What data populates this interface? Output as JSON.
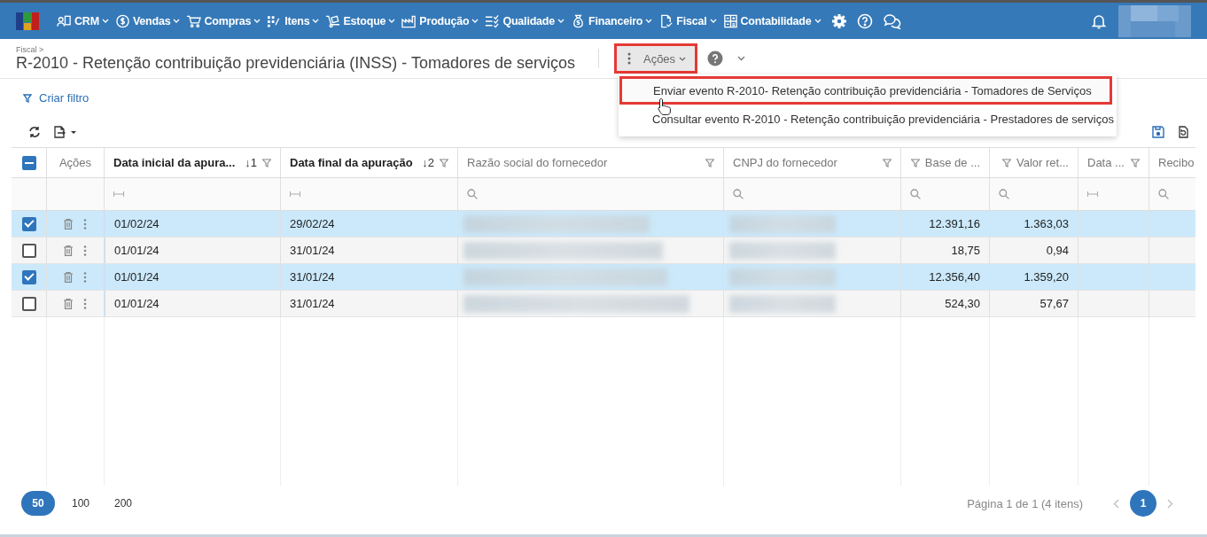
{
  "nav": {
    "items": [
      {
        "label": "CRM",
        "kind": "crm"
      },
      {
        "label": "Vendas",
        "kind": "sales"
      },
      {
        "label": "Compras",
        "kind": "purchases"
      },
      {
        "label": "Itens",
        "kind": "items"
      },
      {
        "label": "Estoque",
        "kind": "stock"
      },
      {
        "label": "Produção",
        "kind": "production"
      },
      {
        "label": "Qualidade",
        "kind": "quality"
      },
      {
        "label": "Financeiro",
        "kind": "finance"
      },
      {
        "label": "Fiscal",
        "kind": "fiscal"
      },
      {
        "label": "Contabilidade",
        "kind": "accounting"
      }
    ]
  },
  "breadcrumb": "Fiscal >",
  "title": "R-2010 - Retenção contribuição previdenciária (INSS) - Tomadores de serviços",
  "actions_button": {
    "label": "Ações",
    "highlighted": true
  },
  "actions_menu": {
    "items": [
      {
        "label": "Enviar evento R-2010- Retenção contribuição previdenciária - Tomadores de Serviços",
        "highlighted": true
      },
      {
        "label": "Consultar evento R-2010 - Retenção contribuição previdenciária - Prestadores de serviços",
        "highlighted": false
      }
    ]
  },
  "filter_link": "Criar filtro",
  "table": {
    "select_all": {
      "indeterminate": true
    },
    "columns": [
      {
        "label": "Ações",
        "kind": "actions",
        "filterable": false
      },
      {
        "label": "Data inicial da apura...",
        "kind": "date",
        "sort": "↓1",
        "filterable": true
      },
      {
        "label": "Data final da apuração",
        "kind": "date",
        "sort": "↓2",
        "filterable": true
      },
      {
        "label": "Razão social do fornecedor",
        "kind": "text",
        "filterable": true
      },
      {
        "label": "CNPJ do fornecedor",
        "kind": "text",
        "filterable": true
      },
      {
        "label": "Base de ...",
        "kind": "number",
        "filterable": true
      },
      {
        "label": "Valor ret...",
        "kind": "number",
        "filterable": true
      },
      {
        "label": "Data ...",
        "kind": "date",
        "filterable": true
      },
      {
        "label": "Recibo",
        "kind": "text",
        "filterable": false
      }
    ],
    "rows": [
      {
        "selected": true,
        "start": "01/02/24",
        "end": "29/02/24",
        "base": "12.391,16",
        "retained": "1.363,03"
      },
      {
        "selected": false,
        "start": "01/01/24",
        "end": "31/01/24",
        "base": "18,75",
        "retained": "0,94"
      },
      {
        "selected": true,
        "start": "01/01/24",
        "end": "31/01/24",
        "base": "12.356,40",
        "retained": "1.359,20"
      },
      {
        "selected": false,
        "start": "01/01/24",
        "end": "31/01/24",
        "base": "524,30",
        "retained": "57,67"
      }
    ]
  },
  "page_sizes": [
    {
      "label": "50",
      "selected": true
    },
    {
      "label": "100",
      "selected": false
    },
    {
      "label": "200",
      "selected": false
    }
  ],
  "pager": {
    "info": "Página 1 de 1 (4 itens)",
    "pages": [
      {
        "label": "1",
        "selected": true
      }
    ]
  }
}
